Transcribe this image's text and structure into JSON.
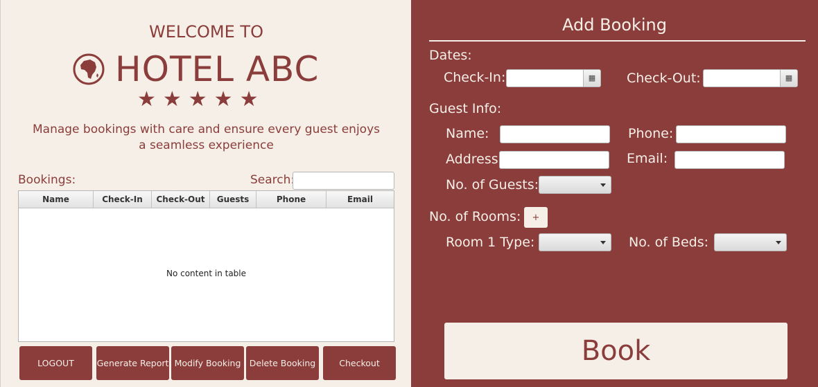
{
  "welcome": {
    "line1": "WELCOME TO",
    "hotel_name": "HOTEL ABC",
    "stars": "★★★★★",
    "tagline": "Manage bookings with care and ensure every guest enjoys a seamless experience"
  },
  "bookings": {
    "label": "Bookings:",
    "search_label": "Search:",
    "search_value": "",
    "columns": [
      "Name",
      "Check-In",
      "Check-Out",
      "Guests",
      "Phone",
      "Email"
    ],
    "empty_text": "No content in table"
  },
  "actions": {
    "logout": "LOGOUT",
    "generate_report": "Generate Report",
    "modify_booking": "Modify Booking",
    "delete_booking": "Delete Booking",
    "checkout": "Checkout"
  },
  "form": {
    "title": "Add Booking",
    "dates_label": "Dates:",
    "checkin_label": "Check-In:",
    "checkout_label": "Check-Out:",
    "checkin_value": "",
    "checkout_value": "",
    "guest_info_label": "Guest Info:",
    "name_label": "Name:",
    "phone_label": "Phone:",
    "address_label": "Address:",
    "email_label": "Email:",
    "guests_label": "No. of Guests:",
    "rooms_label": "No. of Rooms:",
    "add_room_label": "+",
    "room1_type_label": "Room 1 Type:",
    "beds_label": "No. of Beds:",
    "book_label": "Book"
  },
  "colors": {
    "accent": "#8a3d3a",
    "cream": "#f6efe8"
  }
}
